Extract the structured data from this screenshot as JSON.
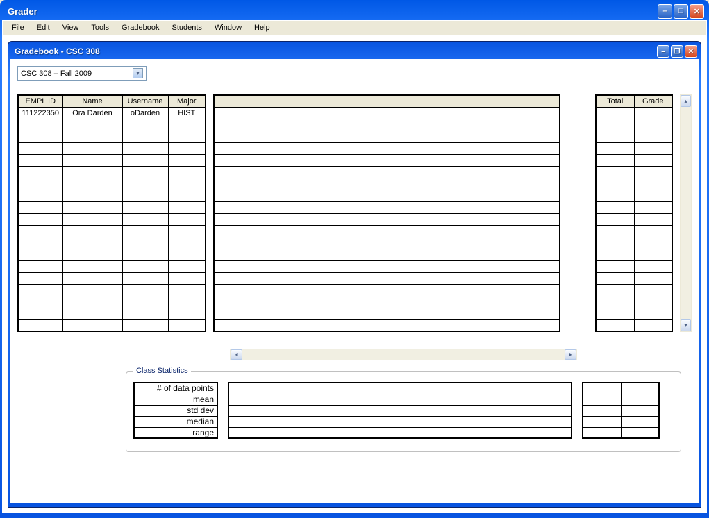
{
  "outer_window": {
    "title": "Grader"
  },
  "menu": {
    "items": [
      "File",
      "Edit",
      "View",
      "Tools",
      "Gradebook",
      "Students",
      "Window",
      "Help"
    ]
  },
  "inner_window": {
    "title": "Gradebook - CSC 308"
  },
  "course_select": {
    "value": "CSC 308 – Fall 2009"
  },
  "student_columns": [
    "EMPL ID",
    "Name",
    "Username",
    "Major"
  ],
  "students": [
    {
      "empl_id": "111222350",
      "name": "Ora Darden",
      "username": "oDarden",
      "major": "HIST"
    }
  ],
  "empty_rows_count": 18,
  "summary_columns": [
    "Total",
    "Grade"
  ],
  "stats": {
    "legend": "Class Statistics",
    "labels": [
      "# of data points",
      "mean",
      "std dev",
      "median",
      "range"
    ]
  }
}
